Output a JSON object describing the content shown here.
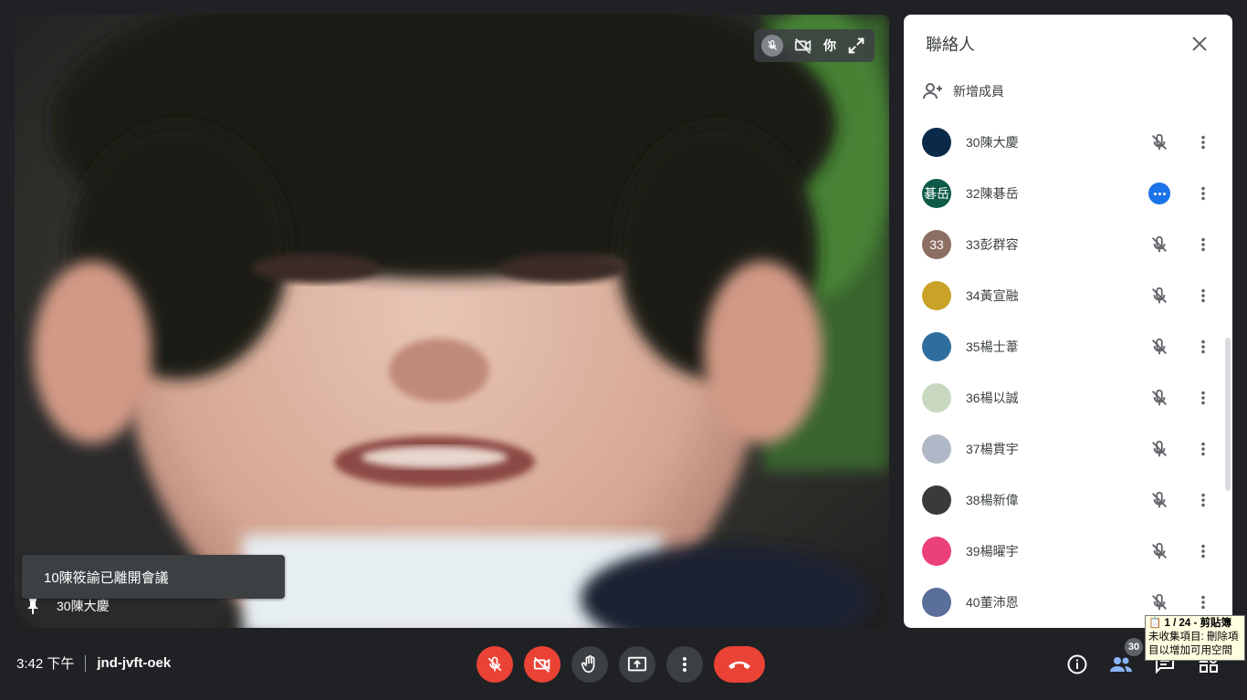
{
  "video": {
    "self_label": "你",
    "pinned_name": "30陳大慶"
  },
  "toast": {
    "text": "10陳筱諭已離開會議"
  },
  "panel": {
    "title": "聯絡人",
    "add_member_label": "新增成員",
    "people": [
      {
        "name": "30陳大慶",
        "avatar_text": "",
        "avatar_color": "#0b2a4a",
        "speaking": false
      },
      {
        "name": "32陳碁岳",
        "avatar_text": "碁岳",
        "avatar_color": "#0d5a47",
        "speaking": true
      },
      {
        "name": "33彭群容",
        "avatar_text": "33",
        "avatar_color": "#8d6e63",
        "speaking": false
      },
      {
        "name": "34黃宣融",
        "avatar_text": "",
        "avatar_color": "#c9a227",
        "speaking": false
      },
      {
        "name": "35楊士葦",
        "avatar_text": "",
        "avatar_color": "#2e6e9e",
        "speaking": false
      },
      {
        "name": "36楊以誠",
        "avatar_text": "",
        "avatar_color": "#c8d8c0",
        "speaking": false
      },
      {
        "name": "37楊貫宇",
        "avatar_text": "",
        "avatar_color": "#b0b8c8",
        "speaking": false
      },
      {
        "name": "38楊新偉",
        "avatar_text": "",
        "avatar_color": "#3a3a3a",
        "speaking": false
      },
      {
        "name": "39楊曜宇",
        "avatar_text": "",
        "avatar_color": "#ec407a",
        "speaking": false
      },
      {
        "name": "40董沛恩",
        "avatar_text": "",
        "avatar_color": "#5a6f9a",
        "speaking": false
      }
    ]
  },
  "bottom": {
    "time": "3:42 下午",
    "meeting_code": "jnd-jvft-oek",
    "participant_count": "30"
  },
  "clipboard_tip": {
    "line1": "📋 1 / 24 - 剪貼簿",
    "line2": "未收集項目: 刪除項",
    "line3": "目以增加可用空間"
  },
  "colors": {
    "accent_blue": "#1a73e8",
    "danger_red": "#ea4335",
    "bar_bg": "#202124"
  }
}
